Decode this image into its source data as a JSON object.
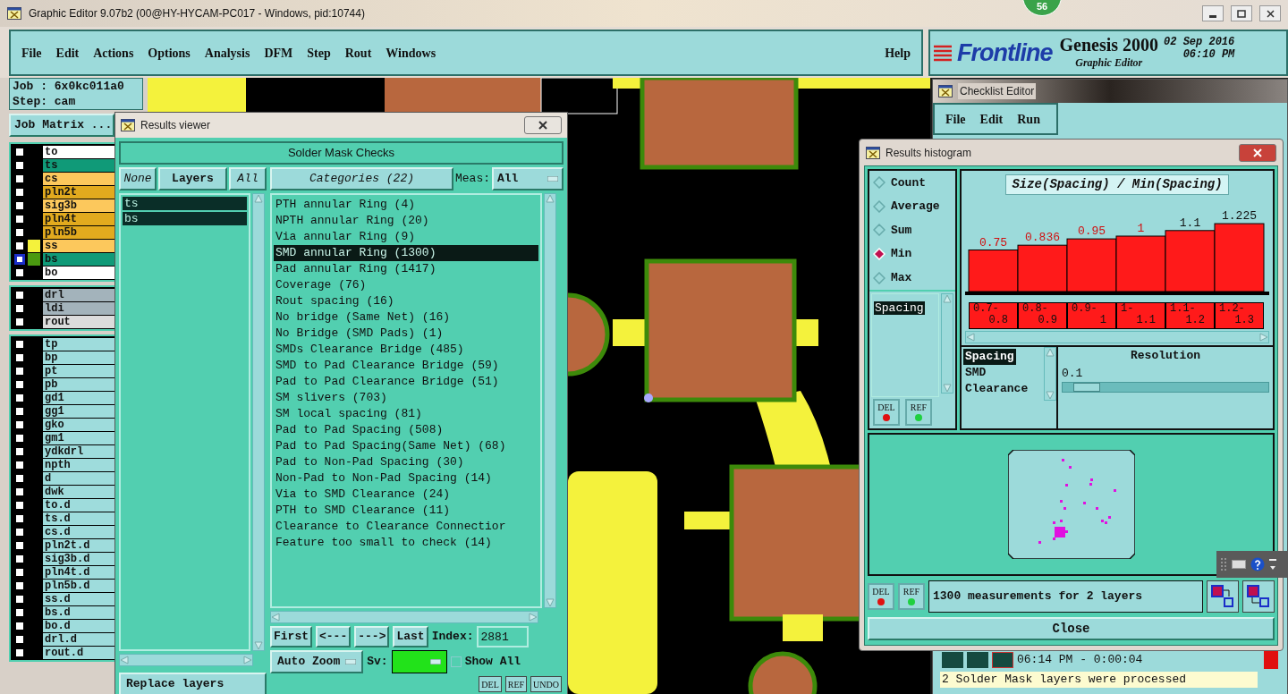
{
  "window": {
    "title": "Graphic Editor 9.07b2 (00@HY-HYCAM-PC017 - Windows, pid:10744)"
  },
  "notification_badge": "56",
  "menu": [
    "File",
    "Edit",
    "Actions",
    "Options",
    "Analysis",
    "DFM",
    "Step",
    "Rout",
    "Windows"
  ],
  "help": "Help",
  "brand": {
    "logo": "Frontline",
    "product": "Genesis 2000",
    "subtitle": "Graphic Editor",
    "date": "02 Sep 2016",
    "time": "06:10 PM"
  },
  "job_panel": {
    "job": "Job : 6x0kc011a0",
    "step": "Step: cam",
    "matrix_button": "Job Matrix ..."
  },
  "layer_groups": [
    {
      "layers": [
        {
          "name": "to",
          "color": "#ffffff",
          "selected": false
        },
        {
          "name": "ts",
          "color": "#109a78",
          "selected": false
        },
        {
          "name": "cs",
          "color": "#fcc85c",
          "selected": false
        },
        {
          "name": "pln2t",
          "color": "#e2aa1e",
          "selected": false
        },
        {
          "name": "sig3b",
          "color": "#fcc85c",
          "selected": false
        },
        {
          "name": "pln4t",
          "color": "#e2aa1e",
          "selected": false
        },
        {
          "name": "pln5b",
          "color": "#e2aa1e",
          "selected": false
        },
        {
          "name": "ss",
          "color": "#fcc85c",
          "swatch": {
            "color": "#f4f23c"
          },
          "selected": false
        },
        {
          "name": "bs",
          "color": "#109a78",
          "swatch": {
            "color": "#4a9a10"
          },
          "selected": true
        },
        {
          "name": "bo",
          "color": "#ffffff",
          "selected": false
        }
      ]
    },
    {
      "layers": [
        {
          "name": "drl",
          "color": "#a3b3bb",
          "selected": false
        },
        {
          "name": "ldi",
          "color": "#a3b3bb",
          "selected": false
        },
        {
          "name": "rout",
          "color": "#dcdcdc",
          "selected": false
        }
      ]
    },
    {
      "layers": [
        {
          "name": "tp",
          "color": "#9edcdc",
          "selected": false
        },
        {
          "name": "bp",
          "color": "#9edcdc",
          "selected": false
        },
        {
          "name": "pt",
          "color": "#9edcdc",
          "selected": false
        },
        {
          "name": "pb",
          "color": "#9edcdc",
          "selected": false
        },
        {
          "name": "gd1",
          "color": "#9edcdc",
          "selected": false
        },
        {
          "name": "gg1",
          "color": "#9edcdc",
          "selected": false
        },
        {
          "name": "gko",
          "color": "#9edcdc",
          "selected": false
        },
        {
          "name": "gm1",
          "color": "#9edcdc",
          "selected": false
        },
        {
          "name": "ydkdrl",
          "color": "#9edcdc",
          "selected": false
        },
        {
          "name": "npth",
          "color": "#9edcdc",
          "selected": false
        },
        {
          "name": "d",
          "color": "#9edcdc",
          "selected": false
        },
        {
          "name": "dwk",
          "color": "#9edcdc",
          "selected": false
        },
        {
          "name": "to.d",
          "color": "#9edcdc",
          "selected": false
        },
        {
          "name": "ts.d",
          "color": "#9edcdc",
          "selected": false
        },
        {
          "name": "cs.d",
          "color": "#9edcdc",
          "selected": false
        },
        {
          "name": "pln2t.d",
          "color": "#9edcdc",
          "selected": false
        },
        {
          "name": "sig3b.d",
          "color": "#9edcdc",
          "selected": false
        },
        {
          "name": "pln4t.d",
          "color": "#9edcdc",
          "selected": false
        },
        {
          "name": "pln5b.d",
          "color": "#9edcdc",
          "selected": false
        },
        {
          "name": "ss.d",
          "color": "#9edcdc",
          "selected": false
        },
        {
          "name": "bs.d",
          "color": "#9edcdc",
          "selected": false
        },
        {
          "name": "bo.d",
          "color": "#9edcdc",
          "selected": false
        },
        {
          "name": "drl.d",
          "color": "#9edcdc",
          "selected": false
        },
        {
          "name": "rout.d",
          "color": "#9edcdc",
          "selected": false
        }
      ]
    }
  ],
  "results_viewer": {
    "title": "Results viewer",
    "header": "Solder Mask Checks",
    "layer_buttons": [
      {
        "label": "None",
        "kind": "italic"
      },
      {
        "label": "Layers",
        "kind": "bold"
      },
      {
        "label": "All",
        "kind": "italic"
      }
    ],
    "layers": [
      {
        "name": "ts",
        "selected": true
      },
      {
        "name": "bs",
        "selected": true
      }
    ],
    "categories_button": "Categories (22)",
    "meas_label": "Meas:",
    "meas_value": "All",
    "categories": [
      {
        "label": "PTH annular Ring (4)",
        "selected": false
      },
      {
        "label": "NPTH annular Ring (20)",
        "selected": false
      },
      {
        "label": "Via annular Ring (9)",
        "selected": false
      },
      {
        "label": "SMD annular Ring (1300)",
        "selected": true
      },
      {
        "label": "Pad annular Ring (1417)",
        "selected": false
      },
      {
        "label": "Coverage (76)",
        "selected": false
      },
      {
        "label": "Rout spacing (16)",
        "selected": false
      },
      {
        "label": "No bridge (Same Net) (16)",
        "selected": false
      },
      {
        "label": "No Bridge (SMD Pads) (1)",
        "selected": false
      },
      {
        "label": "SMDs Clearance Bridge (485)",
        "selected": false
      },
      {
        "label": "SMD to Pad Clearance Bridge (59)",
        "selected": false
      },
      {
        "label": "Pad to Pad Clearance Bridge (51)",
        "selected": false
      },
      {
        "label": "SM slivers (703)",
        "selected": false
      },
      {
        "label": "SM local spacing (81)",
        "selected": false
      },
      {
        "label": "Pad to Pad Spacing (508)",
        "selected": false
      },
      {
        "label": "Pad to Pad Spacing(Same Net) (68)",
        "selected": false
      },
      {
        "label": "Pad to Non-Pad Spacing (30)",
        "selected": false
      },
      {
        "label": "Non-Pad to Non-Pad Spacing (14)",
        "selected": false
      },
      {
        "label": "Via to SMD Clearance (24)",
        "selected": false
      },
      {
        "label": "PTH to SMD Clearance (11)",
        "selected": false
      },
      {
        "label": "Clearance to Clearance Connectior",
        "selected": false
      },
      {
        "label": "Feature too small to check (14)",
        "selected": false
      }
    ],
    "nav_buttons": [
      "First",
      "<---",
      "--->",
      "Last"
    ],
    "index_label": "Index:",
    "index_value": "2881",
    "zoom_menu": "Auto Zoom",
    "sv_label": "Sv:",
    "sv": {
      "color": "#22e21a"
    },
    "show_all": {
      "label": "Show All",
      "checked": false
    },
    "tool_buttons": [
      "DEL",
      "REF",
      "UNDO"
    ],
    "replace_menu": "Replace layers"
  },
  "checklist_editor": {
    "title": "Checklist Editor",
    "menu": [
      "File",
      "Edit",
      "Run"
    ],
    "time": "06:14 PM - 0:00:04",
    "message": "2 Solder Mask layers were processed"
  },
  "histogram": {
    "title": "Results histogram",
    "modes": [
      {
        "label": "Count",
        "selected": false
      },
      {
        "label": "Average",
        "selected": false
      },
      {
        "label": "Sum",
        "selected": false
      },
      {
        "label": "Min",
        "selected": true
      },
      {
        "label": "Max",
        "selected": false
      }
    ],
    "chart_data": {
      "type": "bar",
      "title": "Size(Spacing) / Min(Spacing)",
      "categories": [
        "0.7-0.8",
        "0.8-0.9",
        "0.9-1",
        "1-1.1",
        "1.1-1.2",
        "1.2-1.3"
      ],
      "series": [
        {
          "color": "#ff1a1a",
          "values": [
            0.75,
            0.836,
            0.95,
            1,
            1.1,
            1.225
          ]
        }
      ],
      "data_labels": true
    },
    "measure_list": [
      {
        "label": "Spacing",
        "selected": true
      }
    ],
    "attribute_list": [
      {
        "label": "Spacing",
        "selected": true
      },
      {
        "label": "SMD",
        "selected": false
      },
      {
        "label": "Clearance",
        "selected": false
      }
    ],
    "resolution_label": "Resolution",
    "resolution_value": "0.1",
    "resolution": {
      "level": 0.05
    },
    "list_buttons": [
      "DEL",
      "REF"
    ],
    "footer_buttons": [
      "DEL",
      "REF"
    ],
    "summary": "1300 measurements for 2 layers",
    "close": "Close"
  }
}
